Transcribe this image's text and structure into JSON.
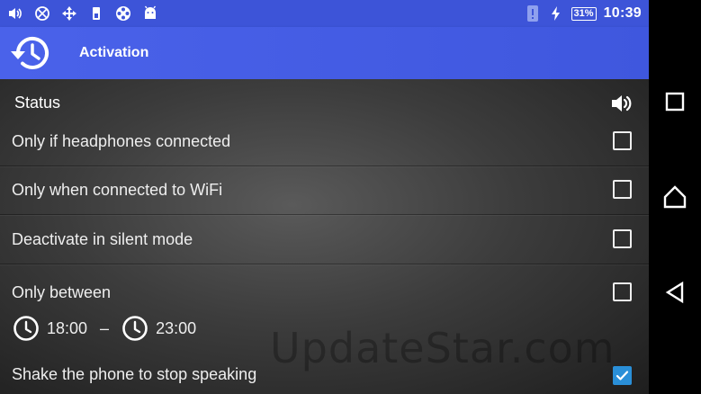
{
  "statusbar": {
    "time": "10:39",
    "battery_percent": "31%",
    "left_icons": [
      "volume-icon",
      "network-icon",
      "sync-icon",
      "sim-icon",
      "film-reel-icon",
      "android-icon"
    ],
    "right_icons": [
      "notification-icon",
      "charging-bolt-icon",
      "battery-icon"
    ]
  },
  "actionbar": {
    "title": "Activation",
    "logo_icon": "history-clock-icon"
  },
  "content": {
    "section_header": "Status",
    "rows": [
      {
        "label": "Only if headphones connected",
        "checked": false
      },
      {
        "label": "Only when connected to WiFi",
        "checked": false
      },
      {
        "label": "Deactivate in silent mode",
        "checked": false
      },
      {
        "label": "Only between",
        "checked": false
      },
      {
        "label": "Shake the phone to stop speaking",
        "checked": true
      }
    ],
    "time_range": {
      "start": "18:00",
      "separator": "–",
      "end": "23:00"
    },
    "watermark": "UpdateStar.com"
  },
  "navbar": {
    "buttons": [
      "recents-icon",
      "home-icon",
      "back-icon"
    ]
  },
  "colors": {
    "statusbar": "#3d54d8",
    "actionbar": "#4a62ea",
    "checkbox_checked": "#2a8fd8"
  }
}
